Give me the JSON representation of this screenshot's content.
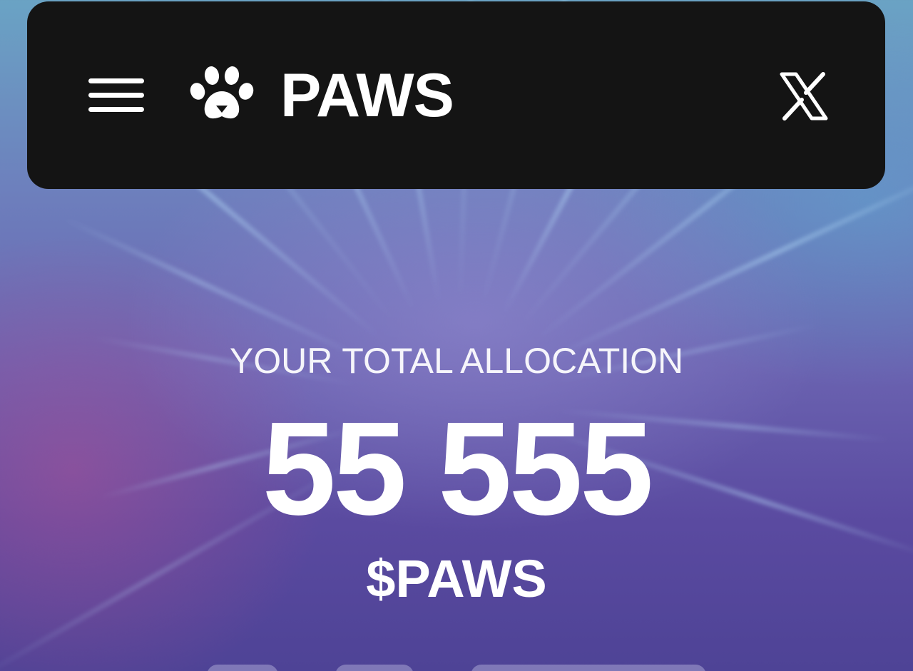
{
  "header": {
    "brand": "PAWS",
    "menu_icon": "hamburger-menu-icon",
    "logo_icon": "paw-logo-icon",
    "social_icon": "x-logo-icon"
  },
  "allocation": {
    "label": "YOUR TOTAL ALLOCATION",
    "amount": "55 555",
    "currency": "$PAWS"
  },
  "colors": {
    "header_bg": "#141414",
    "text": "#ffffff",
    "bg_top": "#6aa3c4",
    "bg_bottom": "#4e4396"
  }
}
